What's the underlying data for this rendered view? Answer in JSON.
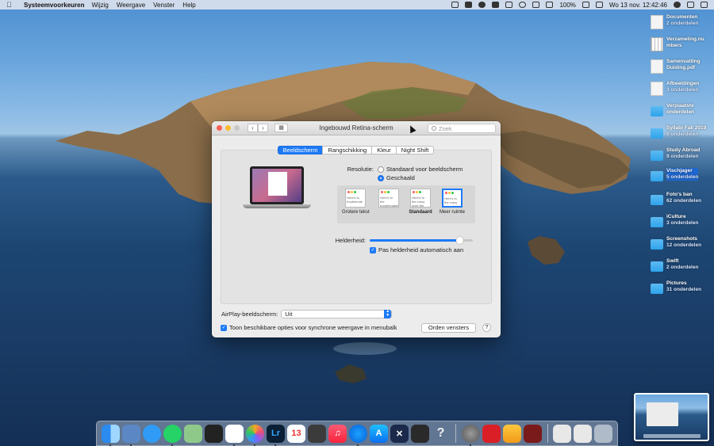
{
  "menubar": {
    "app_name": "Systeemvoorkeuren",
    "menus": [
      "Wijzig",
      "Weergave",
      "Venster",
      "Help"
    ],
    "battery": "100%",
    "battery_icon": "battery-icon",
    "datetime": "Wo 13 nov.  12:42:46"
  },
  "desktop": {
    "items": [
      {
        "icon": "doc",
        "title": "Documenten",
        "subtitle": "2 onderdelen"
      },
      {
        "icon": "sheet",
        "title": "Verzameling.nu mbers",
        "subtitle": ""
      },
      {
        "icon": "doc",
        "title": "Samenvatting Duiding.pdf",
        "subtitle": ""
      },
      {
        "icon": "doc",
        "title": "Afbeeldingen",
        "subtitle": "3 onderdelen"
      },
      {
        "icon": "folder",
        "title": "Verplaatste onderdelen",
        "subtitle": ""
      },
      {
        "icon": "folder",
        "title": "Syllabi Fall 2019",
        "subtitle": "6 onderdelen"
      },
      {
        "icon": "folder",
        "title": "Study Abroad",
        "subtitle": "9 onderdelen"
      },
      {
        "icon": "folder",
        "title": "Vischjager",
        "subtitle": "5 onderdelen"
      },
      {
        "icon": "folder",
        "title": "Foto's ban",
        "subtitle": "62 onderdelen"
      },
      {
        "icon": "folder",
        "title": "iCulture",
        "subtitle": "3 onderdelen"
      },
      {
        "icon": "folder",
        "title": "Screenshots",
        "subtitle": "12 onderdelen"
      },
      {
        "icon": "folder",
        "title": "Swift",
        "subtitle": "2 onderdelen"
      },
      {
        "icon": "folder",
        "title": "Pictures",
        "subtitle": "31 onderdelen"
      }
    ]
  },
  "window": {
    "title": "Ingebouwd Retina-scherm",
    "search_placeholder": "Zoek",
    "tabs": [
      "Beeldscherm",
      "Rangschikking",
      "Kleur",
      "Night Shift"
    ],
    "resolution_label": "Resolutie:",
    "resolution_options": [
      "Standaard voor beeldscherm",
      "Geschaald"
    ],
    "selected_resolution": "Geschaald",
    "scale_options": [
      {
        "caption": "Grotere tekst",
        "sample": "Here's to troublemak"
      },
      {
        "caption": "",
        "sample": "Here's to the troublemakers adven"
      },
      {
        "caption": "Standaard",
        "sample": "Here's to the crazy ones the misfits"
      },
      {
        "caption": "Meer ruimte",
        "sample": "Here's to the crazy ones, the misfits, the rebels"
      }
    ],
    "selected_scale": "Meer ruimte",
    "brightness_label": "Helderheid:",
    "brightness": 0.87,
    "auto_brightness_label": "Pas helderheid automatisch aan",
    "airplay_label": "AirPlay-beeldscherm:",
    "airplay_value": "Uit",
    "mirroring_label": "Toon beschikbare opties voor synchrone weergave in menubalk",
    "arrange_button": "Orden vensters",
    "help_label": "?"
  },
  "dock": {
    "apps": [
      "Finder",
      "Preview",
      "Berichten",
      "WhatsApp",
      "Kaarten",
      "Stocks",
      "Slack",
      "Foto's",
      "Lightroom",
      "Agenda",
      "Script Editor",
      "Muziek",
      "Safari",
      "App Store",
      "Xcode",
      "Scrivener",
      "Help",
      "Systeemvoorkeuren",
      "Creative Cloud",
      "Sketch",
      "Photo Booth"
    ],
    "calendar_day": "13",
    "lightroom_label": "Lr",
    "help_glyph": "?"
  },
  "colors": {
    "accent": "#1e7af6",
    "window_bg": "#ececec"
  }
}
